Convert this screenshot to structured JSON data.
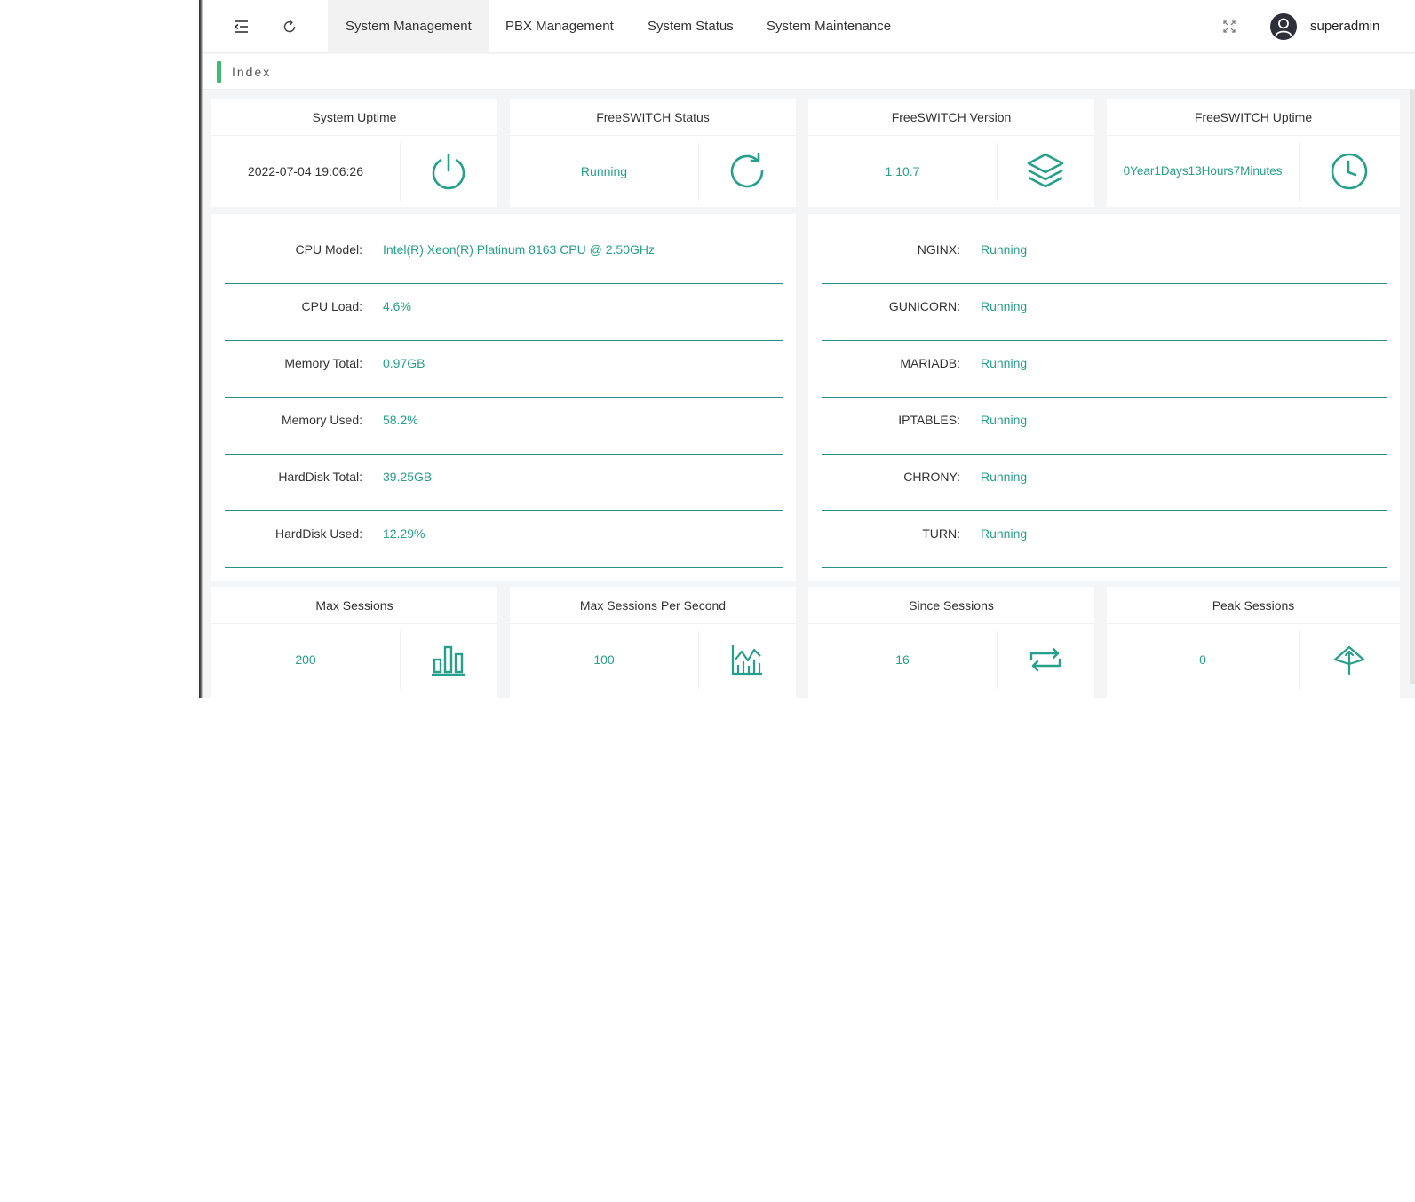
{
  "header": {
    "tabs": [
      {
        "label": "System Management",
        "active": true
      },
      {
        "label": "PBX Management",
        "active": false
      },
      {
        "label": "System Status",
        "active": false
      },
      {
        "label": "System Maintenance",
        "active": false
      }
    ],
    "username": "superadmin"
  },
  "breadcrumb": {
    "label": "Index"
  },
  "summary_cards": [
    {
      "title": "System Uptime",
      "value": "2022-07-04 19:06:26",
      "icon": "power-icon"
    },
    {
      "title": "FreeSWITCH Status",
      "value": "Running",
      "icon": "refresh-icon"
    },
    {
      "title": "FreeSWITCH Version",
      "value": "1.10.7",
      "icon": "layers-icon"
    },
    {
      "title": "FreeSWITCH Uptime",
      "value": "0Year1Days13Hours7Minutes",
      "icon": "clock-icon"
    }
  ],
  "system_info": [
    {
      "label": "CPU Model:",
      "value": "Intel(R) Xeon(R) Platinum 8163 CPU @ 2.50GHz"
    },
    {
      "label": "CPU Load:",
      "value": "4.6%"
    },
    {
      "label": "Memory Total:",
      "value": "0.97GB"
    },
    {
      "label": "Memory Used:",
      "value": "58.2%"
    },
    {
      "label": "HardDisk Total:",
      "value": "39.25GB"
    },
    {
      "label": "HardDisk Used:",
      "value": "12.29%"
    }
  ],
  "services": [
    {
      "label": "NGINX:",
      "value": "Running"
    },
    {
      "label": "GUNICORN:",
      "value": "Running"
    },
    {
      "label": "MARIADB:",
      "value": "Running"
    },
    {
      "label": "IPTABLES:",
      "value": "Running"
    },
    {
      "label": "CHRONY:",
      "value": "Running"
    },
    {
      "label": "TURN:",
      "value": "Running"
    }
  ],
  "session_cards": [
    {
      "title": "Max Sessions",
      "value": "200",
      "icon": "bar-chart-icon"
    },
    {
      "title": "Max Sessions Per Second",
      "value": "100",
      "icon": "line-chart-icon"
    },
    {
      "title": "Since Sessions",
      "value": "16",
      "icon": "repeat-icon"
    },
    {
      "title": "Peak Sessions",
      "value": "0",
      "icon": "peak-icon"
    }
  ],
  "colors": {
    "accent": "#26a08a",
    "breadcrumb_marker": "#3fba72",
    "row_divider": "#2a8f86"
  }
}
